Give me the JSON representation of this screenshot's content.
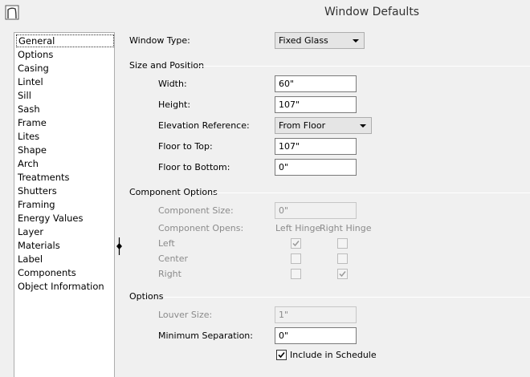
{
  "window": {
    "title": "Window Defaults"
  },
  "categories": [
    "General",
    "Options",
    "Casing",
    "Lintel",
    "Sill",
    "Sash",
    "Frame",
    "Lites",
    "Shape",
    "Arch",
    "Treatments",
    "Shutters",
    "Framing",
    "Energy Values",
    "Layer",
    "Materials",
    "Label",
    "Components",
    "Object Information"
  ],
  "selected_category": "General",
  "window_type": {
    "label": "Window Type:",
    "value": "Fixed Glass"
  },
  "size_position": {
    "heading": "Size and Position",
    "width": {
      "label": "Width:",
      "value": "60\""
    },
    "height": {
      "label": "Height:",
      "value": "107\""
    },
    "elevation_reference": {
      "label": "Elevation Reference:",
      "value": "From Floor"
    },
    "floor_to_top": {
      "label": "Floor to Top:",
      "value": "107\""
    },
    "floor_to_bottom": {
      "label": "Floor to Bottom:",
      "value": "0\""
    }
  },
  "component_options": {
    "heading": "Component Options",
    "component_size": {
      "label": "Component Size:",
      "value": "0\""
    },
    "component_opens": {
      "label": "Component Opens:"
    },
    "left_hinge_header": "Left Hinge",
    "right_hinge_header": "Right Hinge",
    "rows": [
      {
        "label": "Left",
        "left_hinge": true,
        "right_hinge": false
      },
      {
        "label": "Center",
        "left_hinge": false,
        "right_hinge": false
      },
      {
        "label": "Right",
        "left_hinge": false,
        "right_hinge": true
      }
    ]
  },
  "options": {
    "heading": "Options",
    "louver_size": {
      "label": "Louver Size:",
      "value": "1\""
    },
    "minimum_separation": {
      "label": "Minimum Separation:",
      "value": "0\""
    },
    "include_in_schedule": {
      "label": "Include in Schedule",
      "checked": true
    }
  }
}
